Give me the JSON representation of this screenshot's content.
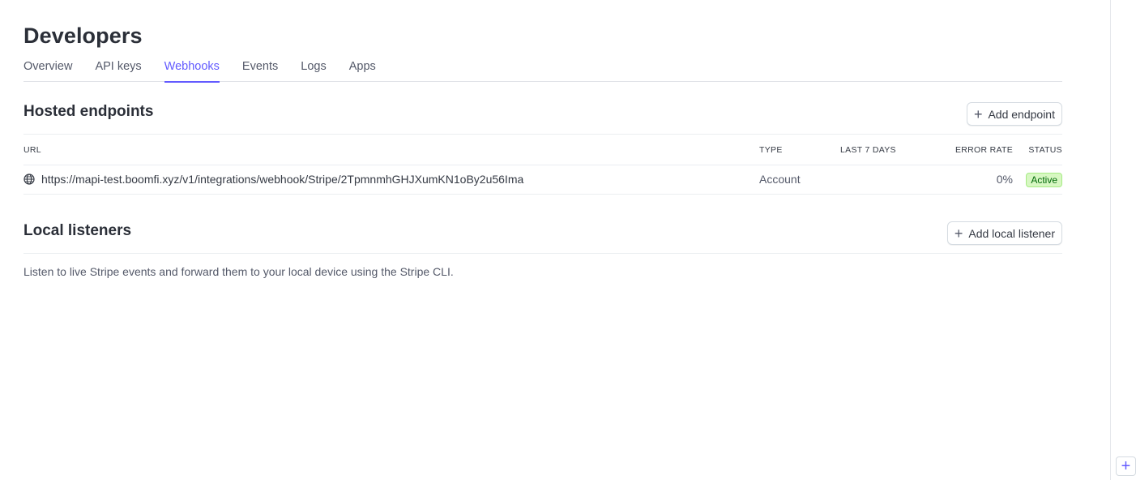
{
  "page": {
    "title": "Developers"
  },
  "tabs": [
    {
      "label": "Overview",
      "active": false
    },
    {
      "label": "API keys",
      "active": false
    },
    {
      "label": "Webhooks",
      "active": true
    },
    {
      "label": "Events",
      "active": false
    },
    {
      "label": "Logs",
      "active": false
    },
    {
      "label": "Apps",
      "active": false
    }
  ],
  "hosted": {
    "title": "Hosted endpoints",
    "add_label": "Add endpoint",
    "columns": {
      "url": "URL",
      "type": "TYPE",
      "last7": "LAST 7 DAYS",
      "error_rate": "ERROR RATE",
      "status": "STATUS"
    },
    "rows": [
      {
        "url": "https://mapi-test.boomfi.xyz/v1/integrations/webhook/Stripe/2TpmnmhGHJXumKN1oBy2u56Ima",
        "type": "Account",
        "last7": "",
        "error_rate": "0%",
        "status": "Active"
      }
    ]
  },
  "local": {
    "title": "Local listeners",
    "add_label": "Add local listener",
    "description": "Listen to live Stripe events and forward them to your local device using the Stripe CLI."
  },
  "colors": {
    "accent": "#635bff",
    "active_badge_bg": "#d7f7c2",
    "active_badge_text": "#006908"
  },
  "icons": {
    "globe": "globe-icon",
    "plus": "plus-icon",
    "corner": "plus-icon"
  }
}
